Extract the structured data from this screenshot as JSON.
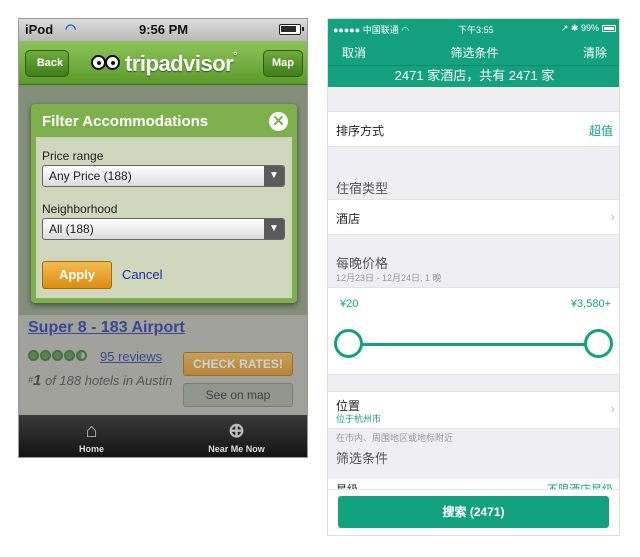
{
  "left": {
    "status": {
      "carrier": "iPod",
      "time": "9:56 PM"
    },
    "nav": {
      "back": "Back",
      "logo": "tripadvisor",
      "logo_mark": "°",
      "map": "Map"
    },
    "hotel": {
      "name": "Super 8 - 183 Airport",
      "reviews": "95 reviews",
      "rank_prefix": "#",
      "rank_num": "1",
      "rank_text": " of 188 hotels in Austin",
      "check_rates": "CHECK RATES!",
      "see_on_map": "See on map"
    },
    "modal": {
      "title": "Filter Accommodations",
      "price_label": "Price range",
      "price_value": "Any Price (188)",
      "neighborhood_label": "Neighborhood",
      "neighborhood_value": "All (188)",
      "apply": "Apply",
      "cancel": "Cancel"
    },
    "tabs": [
      {
        "label": "Home",
        "icon": "home-icon"
      },
      {
        "label": "Near Me Now",
        "icon": "crosshair-icon"
      }
    ]
  },
  "right": {
    "status": {
      "carrier": "中国联通",
      "time": "下午3:55",
      "battery": "99%"
    },
    "nav": {
      "cancel": "取消",
      "title": "筛选条件",
      "clear": "清除"
    },
    "summary": "2471 家酒店，共有 2471 家",
    "sort": {
      "label": "排序方式",
      "value": "超值"
    },
    "lodging": {
      "section": "住宿类型",
      "value": "酒店"
    },
    "price": {
      "section": "每晚价格",
      "dates": "12月23日 - 12月24日, 1 晚",
      "min": "¥20",
      "max": "¥3,580+"
    },
    "location": {
      "label": "位置",
      "value": "位于杭州市",
      "hint": "在市内、周围地区或地标附近"
    },
    "filters": {
      "section": "筛选条件",
      "peek_label": "星级",
      "peek_value": "不限酒店星级"
    },
    "search_button": "搜索 (2471)",
    "accent": "#14a17d"
  }
}
